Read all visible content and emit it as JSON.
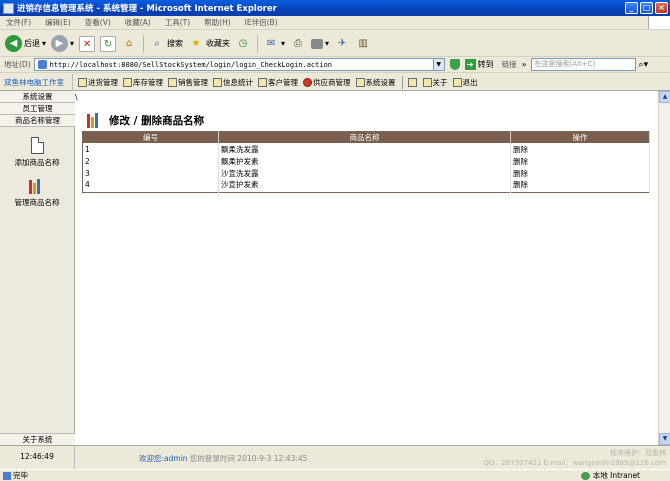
{
  "window": {
    "title": "进销存信息管理系统 - 系统管理 - Microsoft Internet Explorer"
  },
  "menubar": [
    "文件(F)",
    "编辑(E)",
    "查看(V)",
    "收藏(A)",
    "工具(T)",
    "帮助(H)",
    "IE伴侣(B)"
  ],
  "toolbar": {
    "back": "后退",
    "search": "搜索",
    "favorites": "收藏夹"
  },
  "address": {
    "label": "地址(D)",
    "url": "http://localhost:8080/SellStockSystem/login/login_CheckLogin.action",
    "go": "转到",
    "links": "链接",
    "search_placeholder": "在这里搜索(Alt+C)"
  },
  "app": {
    "brand": "双鱼林电脑工作室",
    "nav": [
      "进货管理",
      "库存管理",
      "销售管理",
      "信息统计",
      "客户管理",
      "供应商管理",
      "系统设置"
    ],
    "nav_right": [
      "关于",
      "退出"
    ]
  },
  "sidebar": {
    "buttons": [
      "系统设置",
      "员工管理",
      "商品名称管理"
    ],
    "entries": [
      "添加商品名称",
      "管理商品名称"
    ],
    "about": "关于系统"
  },
  "page": {
    "marker": "\\",
    "title": "修改 / 删除商品名称",
    "columns": [
      "编号",
      "商品名称",
      "操作"
    ],
    "rows": [
      {
        "id": "1",
        "name": "飘柔洗发露",
        "action": "删除"
      },
      {
        "id": "2",
        "name": "飘柔护发素",
        "action": "删除"
      },
      {
        "id": "3",
        "name": "沙宣洗发露",
        "action": "删除"
      },
      {
        "id": "4",
        "name": "沙宣护发素",
        "action": "删除"
      }
    ]
  },
  "footer": {
    "clock": "12:46:49",
    "welcome_prefix": "欢迎您:admin",
    "login_time": "您的登录时间 2010-9-3 12:43:45",
    "credit_line1": "程序维护：双鱼林",
    "credit_line2": "QQ：287307421 E-mail：wangjunlin1985@126.com"
  },
  "status": {
    "left": "完毕",
    "zone": "本地 Intranet"
  },
  "colors": {
    "title_bar": "#0842b8",
    "table_header": "#7a5e4e",
    "brand_text": "#1d5ab8"
  }
}
